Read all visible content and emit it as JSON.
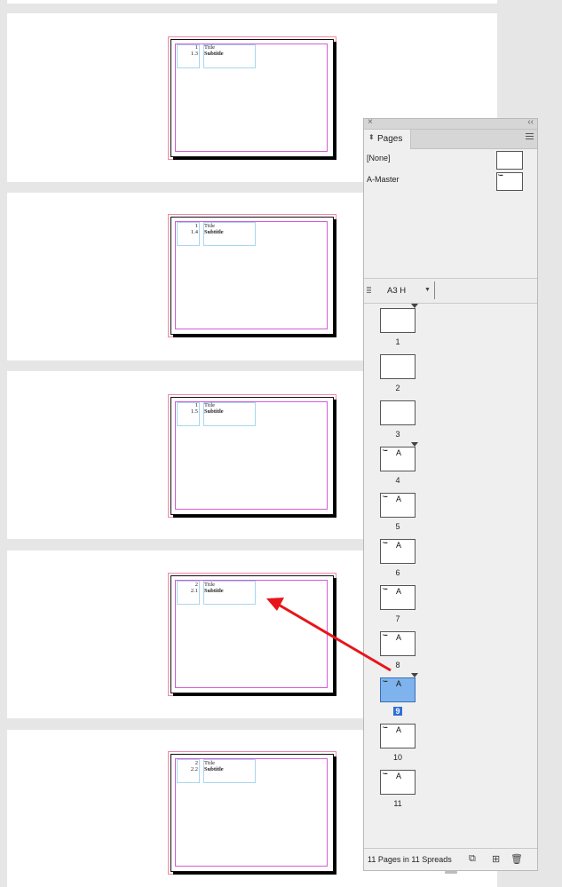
{
  "document": {
    "pages": [
      {
        "num_top": "1",
        "num_bottom": "1.3",
        "title": "Title",
        "subtitle": "Subtitle"
      },
      {
        "num_top": "1",
        "num_bottom": "1.4",
        "title": "Title",
        "subtitle": "Subtitle"
      },
      {
        "num_top": "1",
        "num_bottom": "1.5",
        "title": "Title",
        "subtitle": "Subtitle"
      },
      {
        "num_top": "2",
        "num_bottom": "2.1",
        "title": "Title",
        "subtitle": "Subtitle"
      },
      {
        "num_top": "2",
        "num_bottom": "2.2",
        "title": "Title",
        "subtitle": "Subtitle"
      }
    ]
  },
  "panel": {
    "tab_label": "Pages",
    "masters": [
      {
        "label": "[None]"
      },
      {
        "label": "A-Master"
      }
    ],
    "page_size": "A3 H",
    "pages": [
      {
        "number": "1",
        "master": "",
        "selected": false
      },
      {
        "number": "2",
        "master": "",
        "selected": false
      },
      {
        "number": "3",
        "master": "",
        "selected": false
      },
      {
        "number": "4",
        "master": "A",
        "selected": false
      },
      {
        "number": "5",
        "master": "A",
        "selected": false
      },
      {
        "number": "6",
        "master": "A",
        "selected": false
      },
      {
        "number": "7",
        "master": "A",
        "selected": false
      },
      {
        "number": "8",
        "master": "A",
        "selected": false
      },
      {
        "number": "9",
        "master": "A",
        "selected": true
      },
      {
        "number": "10",
        "master": "A",
        "selected": false
      },
      {
        "number": "11",
        "master": "A",
        "selected": false
      }
    ],
    "footer_text": "11 Pages in 11 Spreads",
    "colors": {
      "selection": "#7fb3ee",
      "annotation_arrow": "#e8141b"
    }
  }
}
